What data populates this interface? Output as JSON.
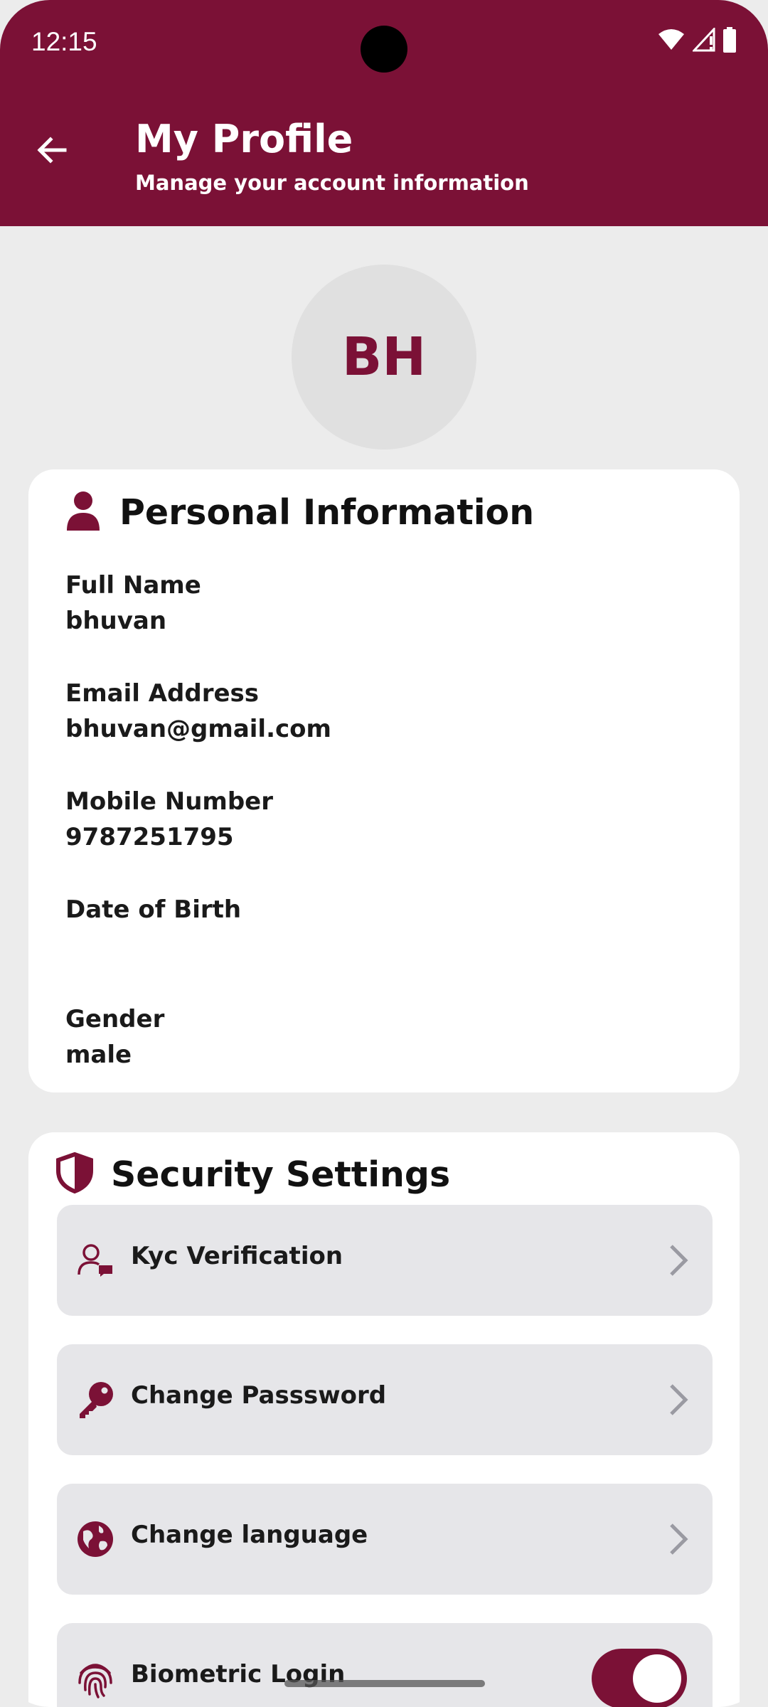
{
  "status_bar": {
    "time": "12:15",
    "icons": [
      "wifi-icon",
      "signal-icon",
      "battery-icon"
    ]
  },
  "header": {
    "title": "My Profile",
    "subtitle": "Manage your account information",
    "back_icon": "arrow-left-icon"
  },
  "avatar": {
    "initials": "BH"
  },
  "personal_info": {
    "title": "Personal Information",
    "icon": "person-icon",
    "fields": [
      {
        "label": "Full Name",
        "value": "bhuvan"
      },
      {
        "label": "Email Address",
        "value": "bhuvan@gmail.com"
      },
      {
        "label": "Mobile Number",
        "value": "9787251795"
      },
      {
        "label": "Date of Birth",
        "value": ""
      },
      {
        "label": "Gender",
        "value": "male"
      }
    ]
  },
  "security": {
    "title": "Security Settings",
    "icon": "shield-icon",
    "items": [
      {
        "label": "Kyc Verification",
        "icon": "user-chat-icon"
      },
      {
        "label": "Change Passsword",
        "icon": "key-icon"
      },
      {
        "label": "Change language",
        "icon": "globe-icon"
      },
      {
        "label": "Biometric Login",
        "icon": "fingerprint-icon",
        "toggle_on": true
      }
    ]
  },
  "colors": {
    "primary": "#7b1136",
    "background": "#ececec",
    "card": "#ffffff",
    "item_bg": "#e6e6e9",
    "chevron": "#9a9aa2"
  }
}
